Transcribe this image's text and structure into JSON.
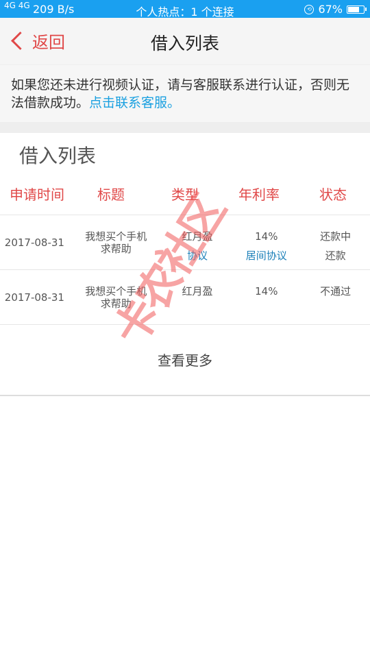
{
  "status_bar": {
    "signal": "4G 4G",
    "speed": "209 B/s",
    "hotspot": "个人热点：1 个连接",
    "battery": "67%",
    "battery_level": 0.67
  },
  "nav": {
    "back_label": "返回",
    "title": "借入列表"
  },
  "notice": {
    "text": "如果您还未进行视频认证，请与客服联系进行认证，否则无法借款成功。",
    "link": "点击联系客服。"
  },
  "section_title": "借入列表",
  "table": {
    "headers": [
      "申请时间",
      "标题",
      "类型",
      "年利率",
      "状态"
    ],
    "rows": [
      {
        "date": "2017-08-31",
        "title": "我想买个手机求帮助",
        "type": "红月盈",
        "type_link": "协议",
        "rate": "14%",
        "rate_link": "居间协议",
        "status": "还款中",
        "action": "还款"
      },
      {
        "date": "2017-08-31",
        "title": "我想买个手机求帮助",
        "type": "红月盈",
        "rate": "14%",
        "status": "不通过"
      }
    ]
  },
  "more": "查看更多",
  "watermark": "卡农社区",
  "colors": {
    "status_bar": "#1aa0f0",
    "accent": "#e04848",
    "link": "#1aa0e0"
  }
}
